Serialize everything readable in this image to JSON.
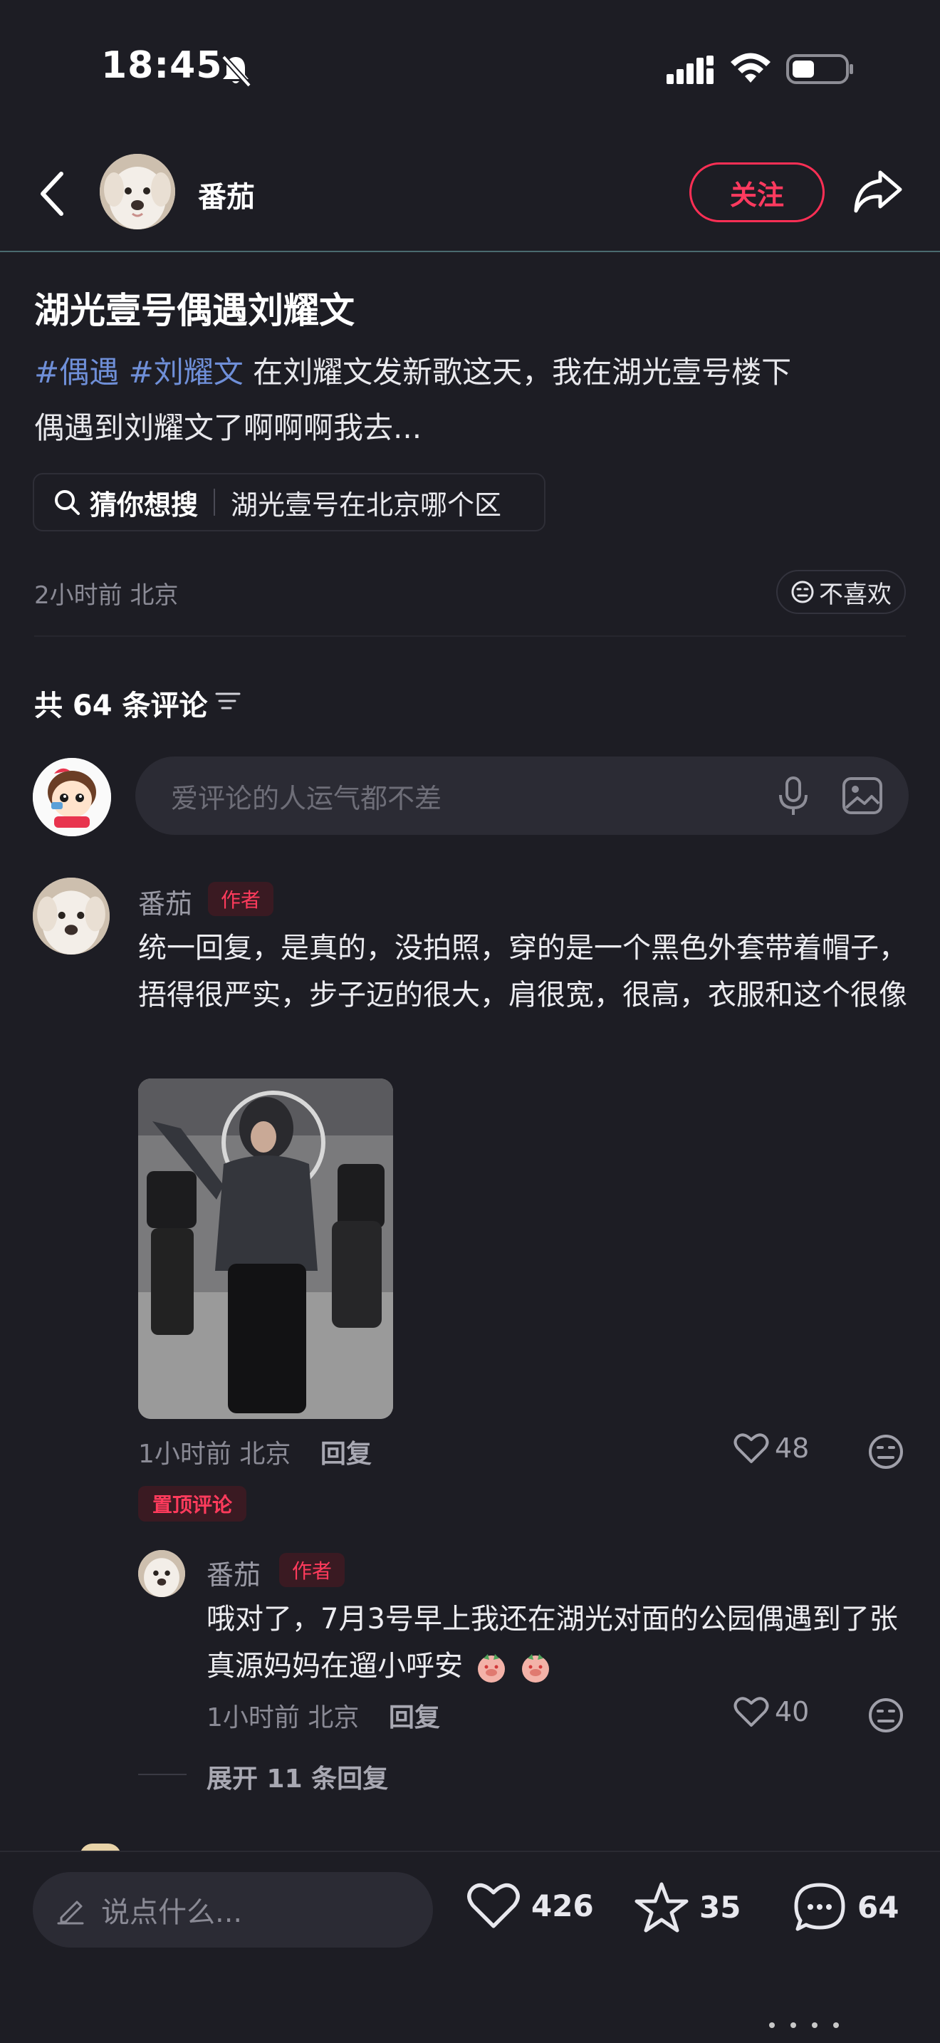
{
  "status_bar": {
    "time": "18:45",
    "icons": [
      "bell-off-icon",
      "signal-icon",
      "wifi-icon",
      "battery-icon"
    ]
  },
  "header": {
    "author_name": "番茄",
    "follow_label": "关注",
    "icons": [
      "back-icon",
      "share-icon"
    ]
  },
  "post": {
    "title": "湖光壹号偶遇刘耀文",
    "hashtags": [
      "#偶遇",
      "#刘耀文"
    ],
    "body_line1": " 在刘耀文发新歌这天，我在湖光壹号楼下",
    "body_line2": "偶遇到刘耀文了啊啊啊我去...",
    "search_label": "猜你想搜",
    "search_query": "湖光壹号在北京哪个区",
    "meta": "2小时前 北京",
    "dislike_label": "不喜欢"
  },
  "comments_section": {
    "count_label": "共 64 条评论",
    "input_placeholder": "爱评论的人运气都不差"
  },
  "comments": [
    {
      "name": "番茄",
      "tag": "作者",
      "text": "统一回复，是真的，没拍照，穿的是一个黑色外套带着帽子，捂得很严实，步子迈的很大，肩很宽，很高，衣服和这个很像",
      "time_location": "1小时前 北京",
      "reply_label": "回复",
      "likes": "48",
      "pinned_label": "置顶评论",
      "replies": [
        {
          "name": "番茄",
          "tag": "作者",
          "text": "哦对了，7月3号早上我还在湖光对面的公园偶遇到了张真源妈妈在遛小呼安",
          "time_location": "1小时前 北京",
          "reply_label": "回复",
          "likes": "40"
        }
      ],
      "expand_label": "展开 11 条回复"
    }
  ],
  "bottom_bar": {
    "input_placeholder": "说点什么...",
    "likes": "426",
    "stars": "35",
    "comments": "64"
  },
  "colors": {
    "background": "#1d1d24",
    "accent": "#ff2f55",
    "hashtag": "#6f8fd8",
    "muted": "#8a8a95"
  }
}
